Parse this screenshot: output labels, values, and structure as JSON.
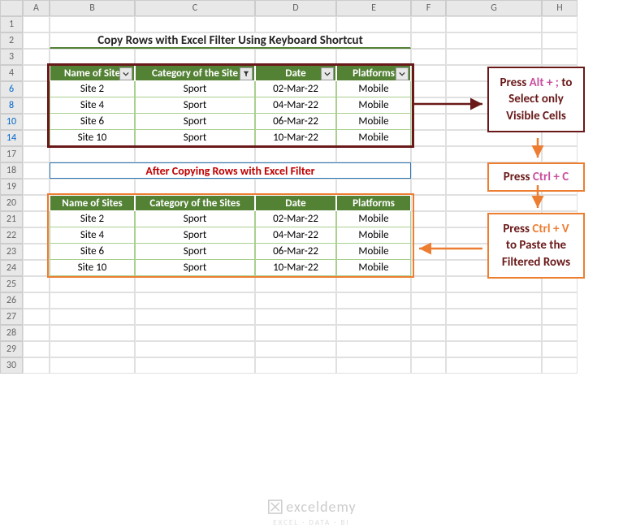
{
  "cols": [
    "A",
    "B",
    "C",
    "D",
    "E",
    "F",
    "G",
    "H"
  ],
  "rows_top": [
    "1",
    "2",
    "3",
    "4",
    "6",
    "8",
    "10",
    "14"
  ],
  "rows_bot": [
    "17",
    "18",
    "19",
    "20",
    "21",
    "22",
    "23",
    "24",
    "25",
    "26",
    "27",
    "28",
    "29",
    "30"
  ],
  "title": "Copy Rows with Excel Filter Using Keyboard Shortcut",
  "subtitle": "After Copying Rows with Excel Filter",
  "t1": {
    "h": [
      "Name of Site",
      "Category of the Site",
      "Date",
      "Platforms"
    ],
    "r": [
      [
        "Site 2",
        "Sport",
        "02-Mar-22",
        "Mobile"
      ],
      [
        "Site 4",
        "Sport",
        "04-Mar-22",
        "Mobile"
      ],
      [
        "Site 6",
        "Sport",
        "06-Mar-22",
        "Mobile"
      ],
      [
        "Site 10",
        "Sport",
        "10-Mar-22",
        "Mobile"
      ]
    ]
  },
  "t2": {
    "h": [
      "Name of Sites",
      "Category of the Sites",
      "Date",
      "Platforms"
    ],
    "r": [
      [
        "Site 2",
        "Sport",
        "02-Mar-22",
        "Mobile"
      ],
      [
        "Site 4",
        "Sport",
        "04-Mar-22",
        "Mobile"
      ],
      [
        "Site 6",
        "Sport",
        "06-Mar-22",
        "Mobile"
      ],
      [
        "Site 10",
        "Sport",
        "10-Mar-22",
        "Mobile"
      ]
    ]
  },
  "callout1_pre": "Press ",
  "callout1_key": "Alt + ;",
  "callout1_post": " to Select only Visible Cells",
  "callout2_pre": "Press ",
  "callout2_key": "Ctrl + C",
  "callout3_pre": "Press ",
  "callout3_key": "Ctrl + V",
  "callout3_post": " to Paste the Filtered Rows",
  "watermark": "exceldemy",
  "watermark_sub": "EXCEL · DATA · BI",
  "chart_data": {
    "type": "table",
    "title": "Copy Rows with Excel Filter Using Keyboard Shortcut",
    "columns": [
      "Name of Site",
      "Category of the Site",
      "Date",
      "Platforms"
    ],
    "rows": [
      [
        "Site 2",
        "Sport",
        "02-Mar-22",
        "Mobile"
      ],
      [
        "Site 4",
        "Sport",
        "04-Mar-22",
        "Mobile"
      ],
      [
        "Site 6",
        "Sport",
        "06-Mar-22",
        "Mobile"
      ],
      [
        "Site 10",
        "Sport",
        "10-Mar-22",
        "Mobile"
      ]
    ]
  }
}
